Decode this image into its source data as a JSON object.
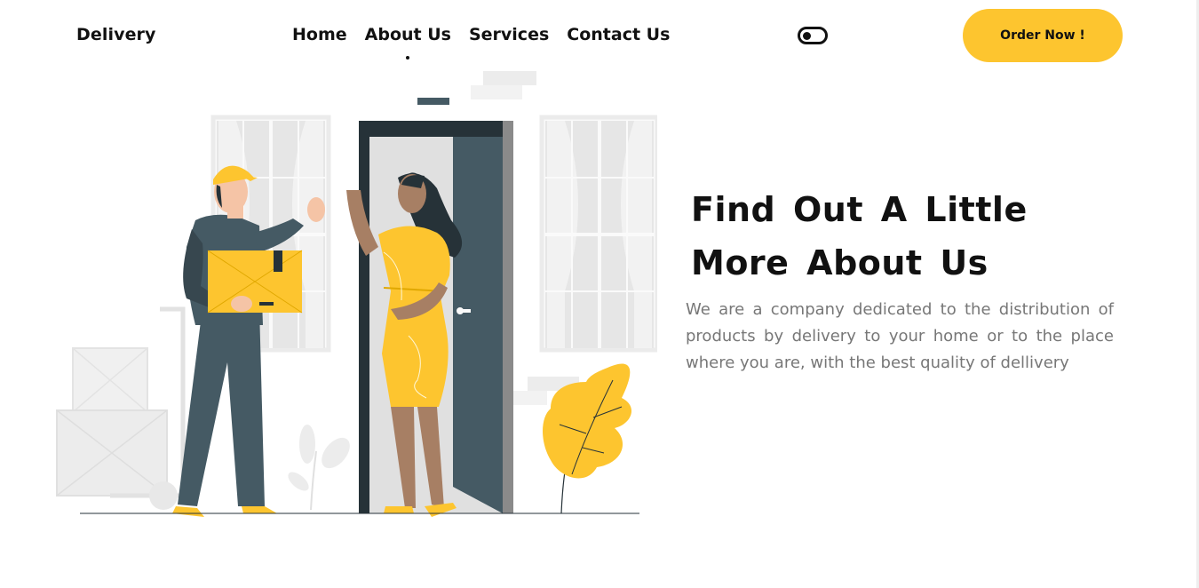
{
  "header": {
    "brand": "Delivery",
    "nav": [
      {
        "label": "Home",
        "active": false
      },
      {
        "label": "About Us",
        "active": true
      },
      {
        "label": "Services",
        "active": false
      },
      {
        "label": "Contact Us",
        "active": false
      }
    ],
    "theme_toggle_icon": "toggle-icon",
    "order_button": "Order Now !"
  },
  "about": {
    "title": "Find Out A Little More About Us",
    "text": "We are a company dedicated to the distribution of products by delivery to your home or to the place where you are, with the best quality of dellivery"
  },
  "colors": {
    "accent": "#fdc52f",
    "dark": "#455a64",
    "text": "#111111",
    "muted": "#777777"
  }
}
